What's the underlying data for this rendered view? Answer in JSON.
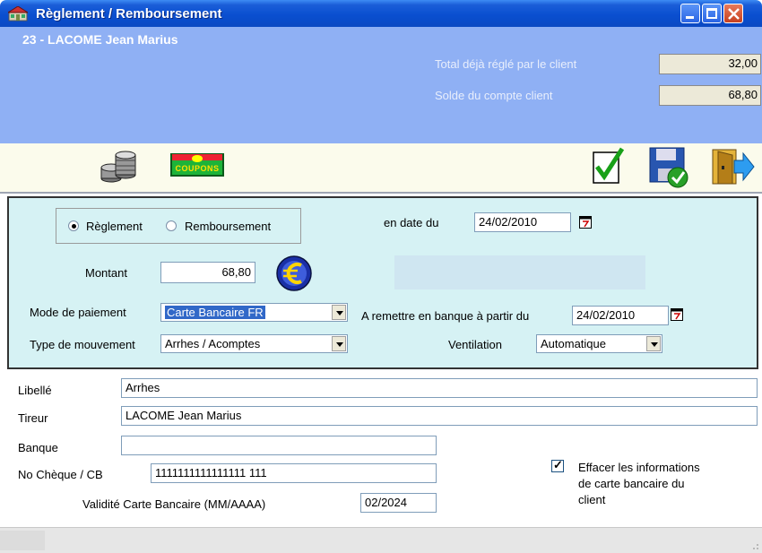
{
  "window": {
    "title": "Règlement / Remboursement"
  },
  "header": {
    "client": "23 - LACOME Jean Marius",
    "total_label": "Total déjà réglé par le client",
    "total_value": "32,00",
    "solde_label": "Solde du compte client",
    "solde_value": "68,80"
  },
  "toolbar": {
    "icons": [
      "coins-icon",
      "coupons-icon",
      "validate-check-icon",
      "save-disk-icon",
      "exit-door-icon"
    ],
    "coupons_label": "COUPONS"
  },
  "form": {
    "radio_reglement": "Règlement",
    "radio_remboursement": "Remboursement",
    "selected_type": "Règlement",
    "date_label": "en date du",
    "date_value": "24/02/2010",
    "montant_label": "Montant",
    "montant_value": "68,80",
    "mode_label": "Mode de paiement",
    "mode_value": "Carte Bancaire FR",
    "type_label": "Type de mouvement",
    "type_value": "Arrhes / Acomptes",
    "remise_label": "A remettre en banque à partir du",
    "remise_value": "24/02/2010",
    "ventilation_label": "Ventilation",
    "ventilation_value": "Automatique"
  },
  "details": {
    "libelle_label": "Libellé",
    "libelle_value": "Arrhes",
    "tireur_label": "Tireur",
    "tireur_value": "LACOME Jean Marius",
    "banque_label": "Banque",
    "banque_value": "",
    "cheque_label": "No Chèque / CB",
    "cheque_value": "1111111111111111 111",
    "validite_label": "Validité Carte Bancaire (MM/AAAA)",
    "validite_value": "02/2024",
    "effacer_line1": "Effacer les informations",
    "effacer_line2": "de carte bancaire du",
    "effacer_line3": "client",
    "effacer_checked": true
  },
  "colors": {
    "titlebar": "#0a4fd0",
    "header_bg": "#8fb0f4",
    "toolbar_bg": "#fbfbec",
    "form_bg": "#d6f2f4",
    "selection": "#3168c8"
  }
}
